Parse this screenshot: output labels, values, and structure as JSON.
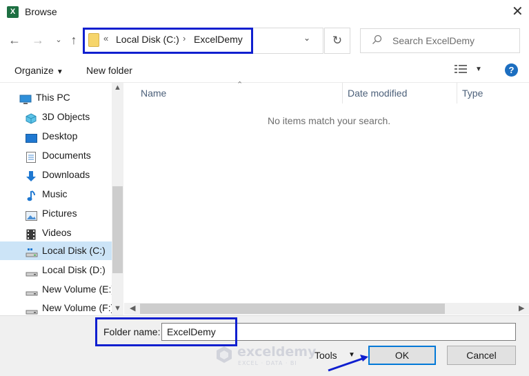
{
  "window": {
    "title": "Browse",
    "app_icon_letter": "X"
  },
  "address": {
    "overflow_glyph": "«",
    "separator": "›",
    "crumbs": [
      "Local Disk (C:)",
      "ExcelDemy"
    ]
  },
  "search": {
    "placeholder": "Search ExcelDemy"
  },
  "toolbar": {
    "organize_label": "Organize",
    "new_folder_label": "New folder",
    "help_label": "?"
  },
  "nav": {
    "items": [
      {
        "label": "This PC",
        "icon": "this-pc-icon",
        "selected": false
      },
      {
        "label": "3D Objects",
        "icon": "3d-objects-icon",
        "selected": false
      },
      {
        "label": "Desktop",
        "icon": "desktop-icon",
        "selected": false
      },
      {
        "label": "Documents",
        "icon": "documents-icon",
        "selected": false
      },
      {
        "label": "Downloads",
        "icon": "downloads-icon",
        "selected": false
      },
      {
        "label": "Music",
        "icon": "music-icon",
        "selected": false
      },
      {
        "label": "Pictures",
        "icon": "pictures-icon",
        "selected": false
      },
      {
        "label": "Videos",
        "icon": "videos-icon",
        "selected": false
      },
      {
        "label": "Local Disk (C:)",
        "icon": "drive-icon",
        "selected": true
      },
      {
        "label": "Local Disk (D:)",
        "icon": "drive-icon",
        "selected": false
      },
      {
        "label": "New Volume (E:)",
        "icon": "drive-icon",
        "selected": false
      },
      {
        "label": "New Volume (F:)",
        "icon": "drive-icon",
        "selected": false
      }
    ]
  },
  "columns": {
    "name": "Name",
    "date_modified": "Date modified",
    "type": "Type"
  },
  "content": {
    "empty_message": "No items match your search."
  },
  "bottom": {
    "folder_name_label": "Folder name:",
    "folder_name_value": "ExcelDemy",
    "tools_label": "Tools",
    "ok_label": "OK",
    "cancel_label": "Cancel"
  },
  "watermark": {
    "name": "exceldemy",
    "tagline": "EXCEL · DATA · BI"
  },
  "colors": {
    "highlight_box": "#0f1fcf",
    "selected_row": "#cce4f7",
    "primary_border": "#0078d7",
    "excel_green": "#1d6f42"
  }
}
